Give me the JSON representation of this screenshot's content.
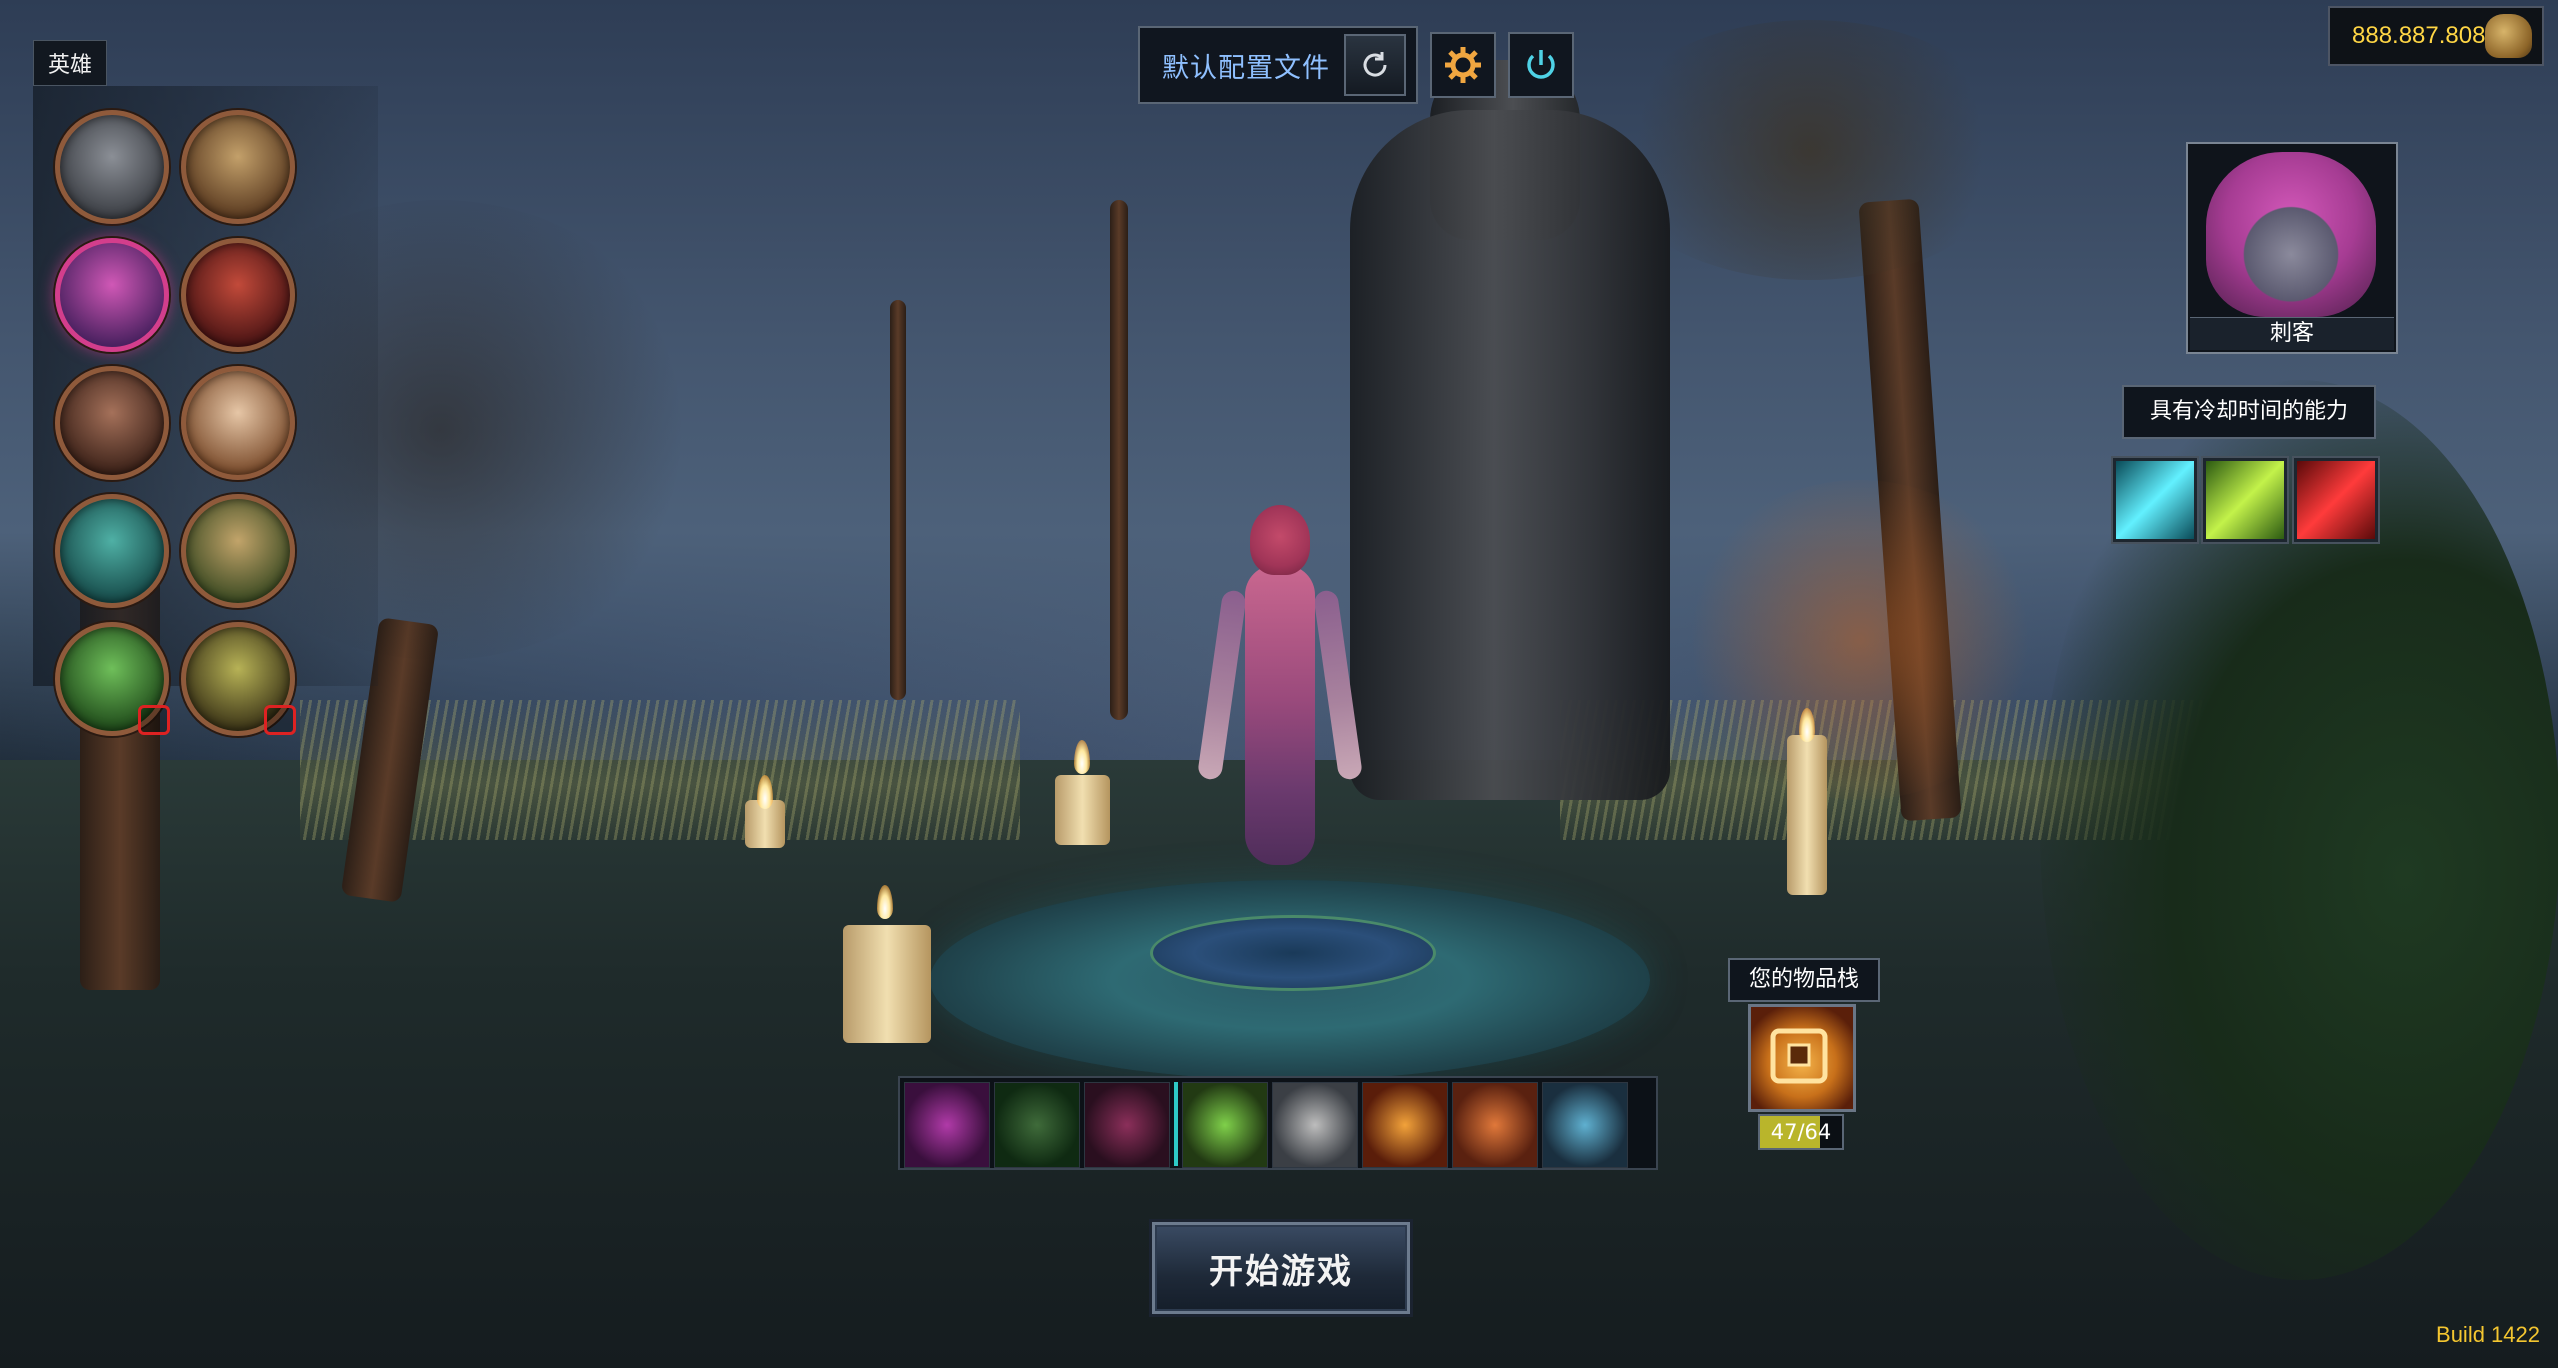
{
  "heroes_tab": {
    "label": "英雄"
  },
  "heroes": [
    {
      "id": "knight",
      "selected": false,
      "locked": false,
      "colors": [
        "#8b8f96",
        "#3b3e44"
      ]
    },
    {
      "id": "hooded",
      "selected": false,
      "locked": false,
      "colors": [
        "#c3a06a",
        "#5a3a20"
      ]
    },
    {
      "id": "assassin",
      "selected": true,
      "locked": false,
      "colors": [
        "#d058b6",
        "#4a2160"
      ]
    },
    {
      "id": "demon",
      "selected": false,
      "locked": false,
      "colors": [
        "#c24a3a",
        "#4a1414"
      ]
    },
    {
      "id": "undead",
      "selected": false,
      "locked": false,
      "colors": [
        "#a5715a",
        "#3b2118"
      ]
    },
    {
      "id": "dwarf",
      "selected": false,
      "locked": false,
      "colors": [
        "#e6c6a6",
        "#7a4b2b"
      ]
    },
    {
      "id": "alien",
      "selected": false,
      "locked": false,
      "colors": [
        "#4fb0a5",
        "#164a49"
      ]
    },
    {
      "id": "goblin",
      "selected": false,
      "locked": false,
      "colors": [
        "#c2a46a",
        "#3b4a22"
      ]
    },
    {
      "id": "orc",
      "selected": false,
      "locked": true,
      "colors": [
        "#6fbf5a",
        "#1f4a1a"
      ]
    },
    {
      "id": "zombie-king",
      "selected": false,
      "locked": true,
      "colors": [
        "#b7b256",
        "#3b3417"
      ]
    }
  ],
  "config": {
    "profile_label": "默认配置文件"
  },
  "currency": {
    "amount": "888.887.808"
  },
  "portrait": {
    "name": "刺客"
  },
  "abilities": {
    "title": "具有冷却时间的能力",
    "items": [
      {
        "icon": "dash-icon",
        "colors": [
          "#62f0ff",
          "#0a4b58"
        ]
      },
      {
        "icon": "blade-icon",
        "colors": [
          "#c3f24a",
          "#2c5a12"
        ]
      },
      {
        "icon": "blood-slash-icon",
        "colors": [
          "#ff3b3b",
          "#5a0a0a"
        ]
      }
    ]
  },
  "equipment": [
    {
      "icon": "gauntlet-icon",
      "colors": [
        "#b03aa8",
        "#3a0f3d"
      ]
    },
    {
      "icon": "scythe-icon",
      "colors": [
        "#3f6b3a",
        "#0f2a12"
      ]
    },
    {
      "icon": "bow-icon",
      "colors": [
        "#8b2f5a",
        "#2a0f1f"
      ]
    },
    {
      "icon": "gloves-icon",
      "colors": [
        "#7fd04a",
        "#223a13"
      ]
    },
    {
      "icon": "shield-icon",
      "colors": [
        "#bdbdbd",
        "#3b3f45"
      ]
    },
    {
      "icon": "ring-icon",
      "colors": [
        "#f2a23a",
        "#5a1d0a"
      ]
    },
    {
      "icon": "cape-icon",
      "colors": [
        "#e0783a",
        "#5a2110"
      ]
    },
    {
      "icon": "amulet-icon",
      "colors": [
        "#5fb0d0",
        "#1a2f3f"
      ]
    }
  ],
  "inventory": {
    "label": "您的物品栈",
    "count": "47/64",
    "fill_fraction": 0.734
  },
  "start_button": {
    "label": "开始游戏"
  },
  "build": "Build 1422"
}
